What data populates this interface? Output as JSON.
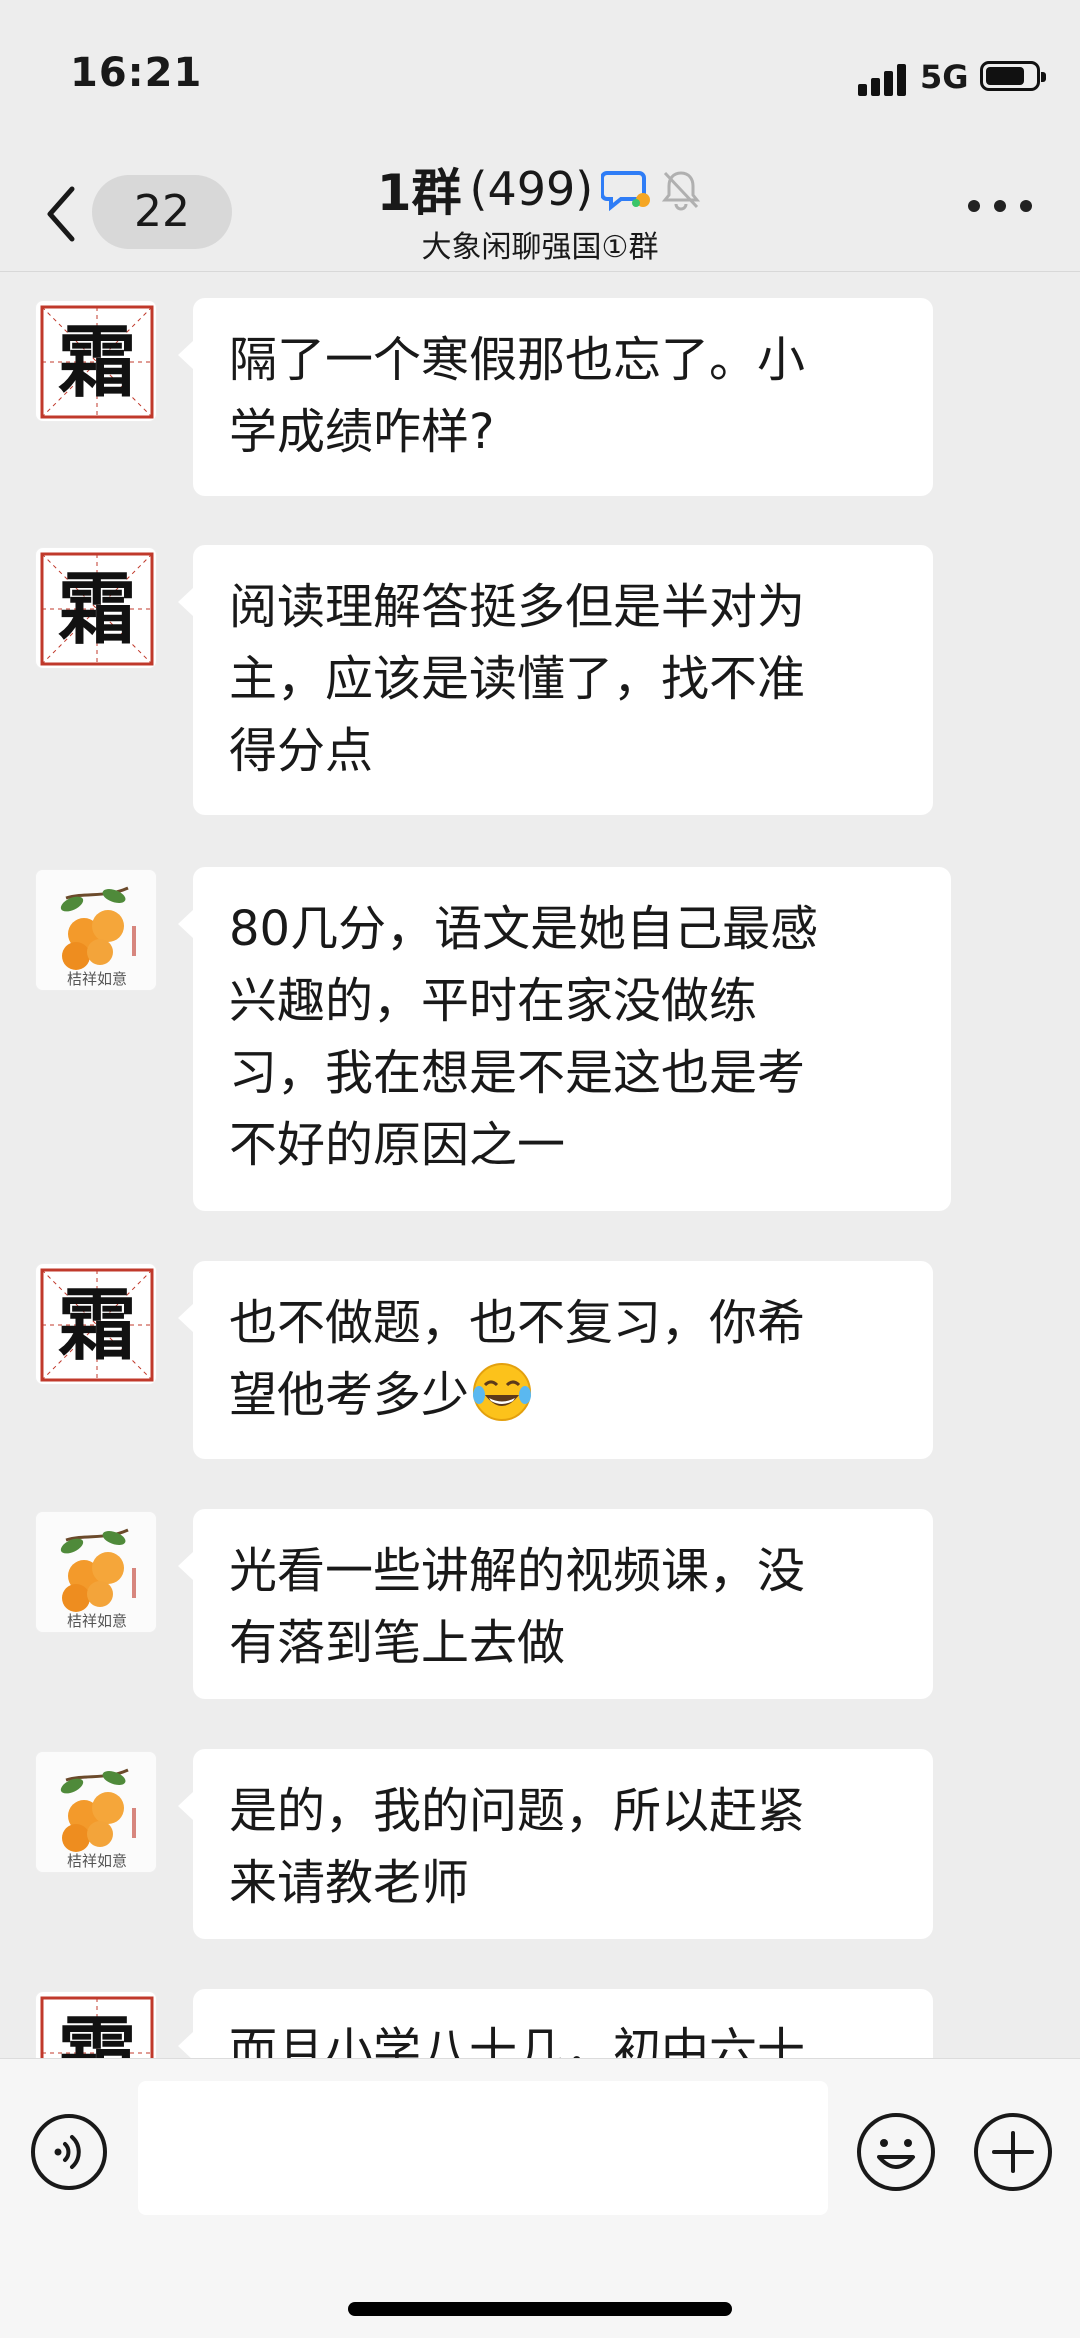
{
  "status_bar": {
    "time": "16:21",
    "network": "5G"
  },
  "nav": {
    "unread_count": "22",
    "title": "1群",
    "member_count": "(499)",
    "subtitle": "大象闲聊强国①群"
  },
  "avatars": {
    "shuang_char": "霜",
    "orange_caption": "桔祥如意"
  },
  "messages": [
    {
      "sender": "shuang",
      "text": "隔了一个寒假那也忘了。小\n学成绩咋样?"
    },
    {
      "sender": "shuang",
      "text": "阅读理解答挺多但是半对为\n主，应该是读懂了，找不准\n得分点"
    },
    {
      "sender": "orange",
      "text": "80几分，语文是她自己最感\n兴趣的，平时在家没做练\n习，我在想是不是这也是考\n不好的原因之一"
    },
    {
      "sender": "shuang",
      "text": "也不做题，也不复习，你希\n望他考多少",
      "emoji": "face-with-tears-of-joy"
    },
    {
      "sender": "orange",
      "text": "光看一些讲解的视频课，没\n有落到笔上去做"
    },
    {
      "sender": "orange",
      "text": "是的，我的问题，所以赶紧\n来请教老师"
    },
    {
      "sender": "shuang",
      "text": "而且小学八十几，初中六十"
    }
  ],
  "input": {
    "placeholder": ""
  },
  "colors": {
    "background": "#ededed",
    "bubble": "#ffffff",
    "accent_blue": "#2f7df6",
    "avatar_border_red": "#c0392b"
  }
}
